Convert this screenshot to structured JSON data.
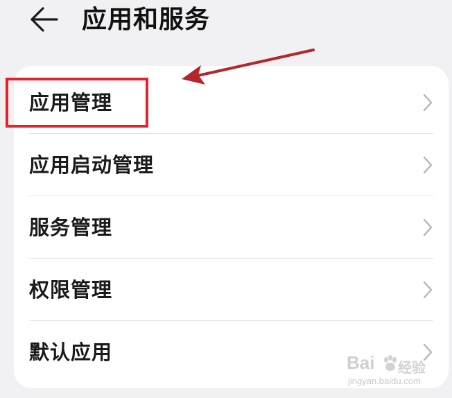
{
  "header": {
    "back_icon": "arrow-left-icon",
    "title": "应用和服务"
  },
  "menu": {
    "items": [
      {
        "label": "应用管理",
        "icon": "chevron-right-icon",
        "highlighted": true
      },
      {
        "label": "应用启动管理",
        "icon": "chevron-right-icon",
        "highlighted": false
      },
      {
        "label": "服务管理",
        "icon": "chevron-right-icon",
        "highlighted": false
      },
      {
        "label": "权限管理",
        "icon": "chevron-right-icon",
        "highlighted": false
      },
      {
        "label": "默认应用",
        "icon": "chevron-right-icon",
        "highlighted": false
      }
    ]
  },
  "annotation": {
    "box_color": "#e8202a",
    "arrow_color": "#b3262b"
  },
  "watermark": {
    "brand": "Bai",
    "sub": "经验",
    "url": "jingyan.baidu.com"
  },
  "colors": {
    "background": "#f1f1f3",
    "card": "#ffffff",
    "text": "#1a1a1a",
    "chevron": "#b5b5b8"
  }
}
